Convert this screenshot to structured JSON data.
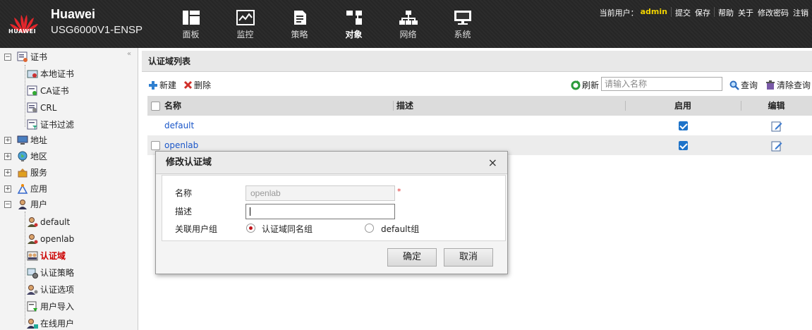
{
  "header": {
    "brand": "Huawei",
    "model": "USG6000V1-ENSP",
    "logo_text": "HUAWEI",
    "nav": [
      {
        "label": "面板",
        "icon": "dashboard-icon"
      },
      {
        "label": "监控",
        "icon": "monitor-icon"
      },
      {
        "label": "策略",
        "icon": "policy-icon"
      },
      {
        "label": "对象",
        "icon": "object-icon",
        "active": true
      },
      {
        "label": "网络",
        "icon": "network-icon"
      },
      {
        "label": "系统",
        "icon": "system-icon"
      }
    ],
    "current_user_label": "当前用户：",
    "current_user": "admin",
    "links": [
      "提交",
      "保存",
      "帮助",
      "关于",
      "修改密码",
      "注销"
    ]
  },
  "sidebar": {
    "collapse_glyph": "«",
    "items": [
      {
        "label": "证书",
        "level": 0,
        "toggle": "−"
      },
      {
        "label": "本地证书",
        "level": 1
      },
      {
        "label": "CA证书",
        "level": 1
      },
      {
        "label": "CRL",
        "level": 1
      },
      {
        "label": "证书过滤",
        "level": 1
      },
      {
        "label": "地址",
        "level": 0,
        "toggle": "+"
      },
      {
        "label": "地区",
        "level": 0,
        "toggle": "+"
      },
      {
        "label": "服务",
        "level": 0,
        "toggle": "+"
      },
      {
        "label": "应用",
        "level": 0,
        "toggle": "+"
      },
      {
        "label": "用户",
        "level": 0,
        "toggle": "−"
      },
      {
        "label": "default",
        "level": 1
      },
      {
        "label": "openlab",
        "level": 1
      },
      {
        "label": "认证域",
        "level": 1,
        "selected": true
      },
      {
        "label": "认证策略",
        "level": 1
      },
      {
        "label": "认证选项",
        "level": 1
      },
      {
        "label": "用户导入",
        "level": 1
      },
      {
        "label": "在线用户",
        "level": 1
      }
    ]
  },
  "panel": {
    "title": "认证域列表",
    "new_label": "新建",
    "delete_label": "删除",
    "refresh_label": "刷新",
    "search_placeholder": "请输入名称",
    "query_label": "查询",
    "clear_label": "清除查询"
  },
  "table": {
    "columns": [
      "名称",
      "描述",
      "启用",
      "编辑"
    ],
    "rows": [
      {
        "name": "default",
        "desc": "",
        "enabled": true
      },
      {
        "name": "openlab",
        "desc": "",
        "enabled": true
      }
    ]
  },
  "dialog": {
    "title": "修改认证域",
    "close": "×",
    "name_label": "名称",
    "name_value": "openlab",
    "required_mark": "*",
    "desc_label": "描述",
    "desc_value": "",
    "group_label": "关联用户组",
    "option1": "认证域同名组",
    "option2": "default组",
    "ok_label": "确定",
    "cancel_label": "取消"
  }
}
